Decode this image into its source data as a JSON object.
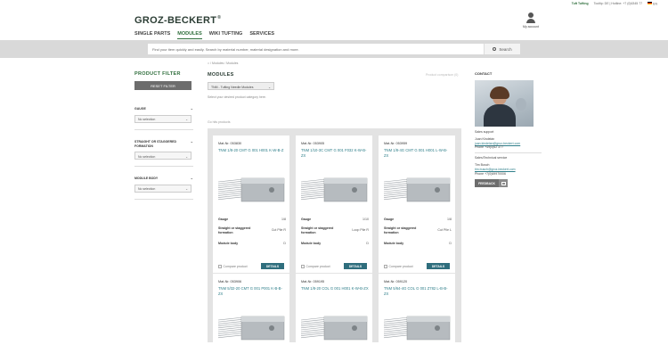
{
  "topbar": {
    "tufting": "Tuft Tufting",
    "info": "Tooltip: DE | Hotline: +7 (0)6345 77",
    "lang": "EN"
  },
  "header": {
    "logo": "GROZ-BECKERT",
    "logo_reg": "®",
    "account_label": "My account"
  },
  "nav": {
    "items": [
      "SINGLE PARTS",
      "MODULES",
      "WIKI TUFTING",
      "SERVICES"
    ],
    "active": 1
  },
  "search": {
    "placeholder": "Find your item quickly and easily. Search by material number, material designation and more.",
    "button": "Search"
  },
  "breadcrumb": "⌂ / Modules / Modules",
  "filter": {
    "title": "PRODUCT FILTER",
    "reset": "RESET FILTER",
    "groups": [
      {
        "label": "GAUGE",
        "value": "No selection"
      },
      {
        "label": "STRAIGHT OR STAGGERED FORMATION",
        "value": "No selection"
      },
      {
        "label": "MODULE BODY",
        "value": "No selection"
      }
    ]
  },
  "modules": {
    "title": "MODULES",
    "hint": "Product comparison (0)",
    "category": "TNM - Tufting Needle Modules",
    "category_note": "Select your desired product category here.",
    "count": "Go hits products"
  },
  "spec_labels": {
    "gauge": "Gauge",
    "formation": "Straight or staggered formation",
    "body": "Module body"
  },
  "card_actions": {
    "compare": "Compare product",
    "details": "DETAILS"
  },
  "products": [
    {
      "matnr": "Mat-Nr. 053830",
      "title": "TNM 1/8-20 CMT G 001 H001 K-W-B-Z",
      "gauge": "1/8",
      "formation": "Cut Pile R",
      "body": "D"
    },
    {
      "matnr": "Mat-Nr. 053905",
      "title": "TNM 1/10-3C CMT G 001 F032 K-W-B-ZX",
      "gauge": "1/10",
      "formation": "Loop Pile R",
      "body": "D"
    },
    {
      "matnr": "Mat-Nr. 053959",
      "title": "TNM 1/8-4G CMT G 001 H001 L-W-B-ZX",
      "gauge": "1/8",
      "formation": "Cut Pile L",
      "body": "D"
    },
    {
      "matnr": "Mat-Nr. 053906",
      "title": "TNM 5/32-20 CMT G 001 P001 K-B-B-ZX"
    },
    {
      "matnr": "Mat-Nr. 059195",
      "title": "TNM 1/8-20 COL G 001 H001 K-W-B-ZX"
    },
    {
      "matnr": "Mat-Nr. 059120",
      "title": "TNM 5/64-4G COL G 001 Z782 L-B-B-ZX"
    }
  ],
  "contact": {
    "title": "CONTACT",
    "sales_label": "Sales support",
    "sales_name": "Juan Kindelán",
    "sales_mail": "juan.kindelan@groz-beckert.com",
    "sales_phone": "Phone +49(0)62 377",
    "tech_label": "Sales/Technical service",
    "tech_name": "Tim Busch",
    "tech_mail": "tim.busch@groz-beckert.com",
    "tech_phone": "Phone +7(0)69970006",
    "feedback": "FEEDBACK"
  },
  "colors": {
    "brand_green": "#2f6e3c",
    "link_teal": "#2f7f8a",
    "button_teal": "#2f6e7d"
  }
}
